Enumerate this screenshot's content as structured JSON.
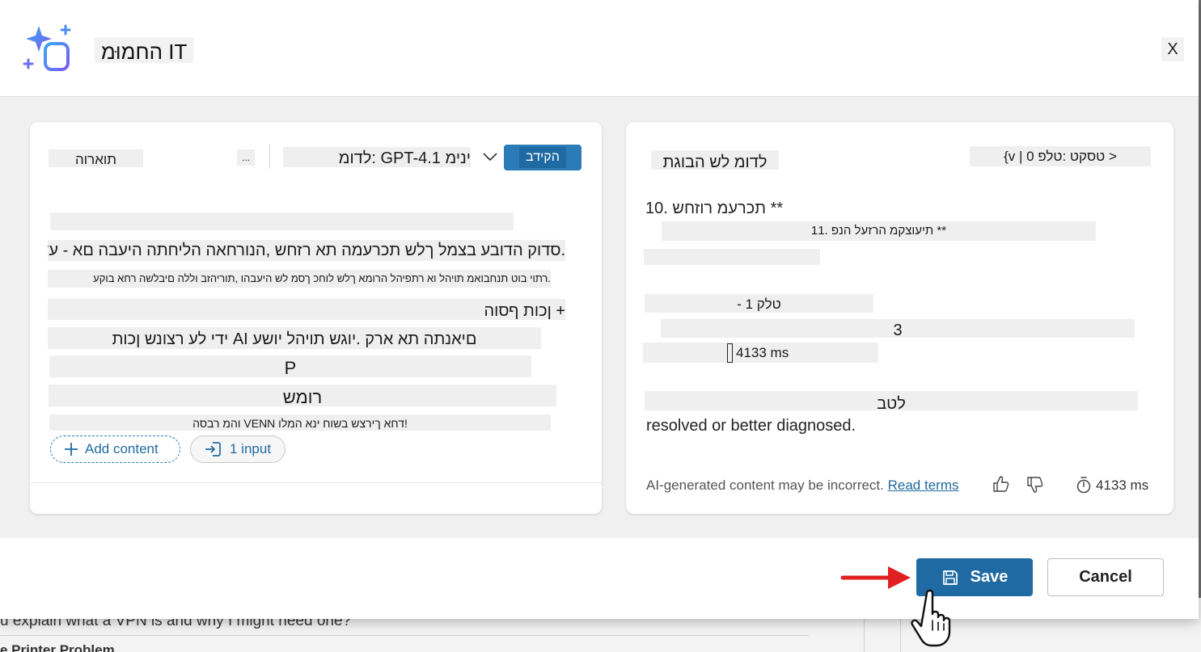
{
  "background": {
    "line1": "u explain what a VPN is and why I might need one?",
    "line2": "e Printer Problem"
  },
  "dialog": {
    "title": "IT החמוּמ",
    "close_label": "X"
  },
  "left_card": {
    "tab_label": "תוארוה",
    "more_label": "...",
    "model_label": "ינימ GPT-4.1 :לדומ",
    "publish_label": "הקידב",
    "lines": [
      ".סדוק הדובע בצמל ךלש תכרעמה תא רזחש ,הנורחאה הליחתה היעבה םא - עדימ",
      ".רתוי בוט תנחבואמ תויהל וא רתפיהל הרומא ךלש לוחכ ךסמ לש היעבהו ,תוריהזב וללה םיבלשה רחא בוקע",
      "+ ןכות ףסוה",
      "םיאנתה תא ארק .יוגש תויהל יושע AI ידי לע רצונש ןכות",
      "P",
      "רומש",
      "!דחא ךירצש בשוח ינא המלו VENN והמ רבסה"
    ],
    "add_content_label": "Add content",
    "input_label": "1 input"
  },
  "right_card": {
    "header_title": "לדומ לש הבוגת",
    "header_meta": "< טסקט :טלפ 0 | v}",
    "lines": [
      "** תכרעמ רוזחש .10",
      "** תיעוצקמ הרזעל הנפ .11",
      "טלק 1 -",
      "3",
      "4133 ms",
      "לטב"
    ],
    "resolved_text": "resolved or better diagnosed.",
    "footer_disclaimer": "AI-generated content may be incorrect.",
    "read_terms": "Read terms",
    "duration": "4133 ms"
  },
  "footer": {
    "save_label": "Save",
    "cancel_label": "Cancel"
  },
  "colors": {
    "accent": "#1f6aa2",
    "pointer_arrow": "#e02020",
    "icon_gradient_start": "#3ba7f5",
    "icon_gradient_end": "#7b5cf0"
  }
}
